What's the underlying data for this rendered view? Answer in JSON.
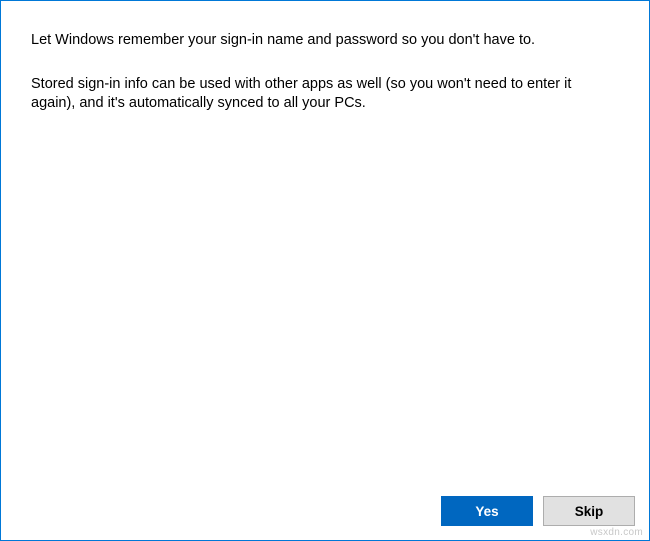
{
  "content": {
    "paragraph1": "Let Windows remember your sign-in name and password so you don't have to.",
    "paragraph2": "Stored sign-in info can be used with other apps as well (so you won't need to enter it again), and it's automatically synced to all your PCs."
  },
  "buttons": {
    "yes": "Yes",
    "skip": "Skip"
  },
  "watermark": "wsxdn.com"
}
